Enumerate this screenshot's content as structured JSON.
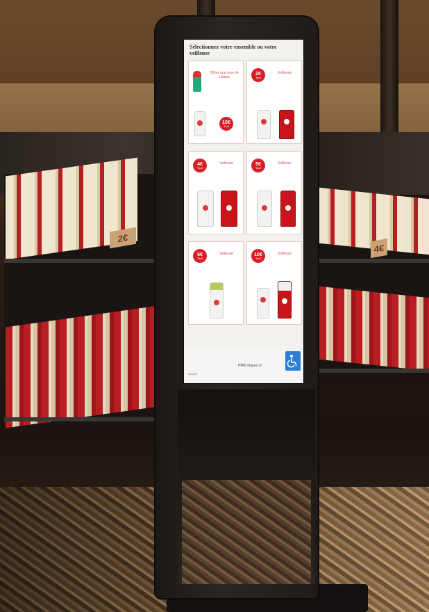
{
  "screen": {
    "title": "Sélectionnez votre ensemble ou votre veilleuse",
    "cards": [
      {
        "id": "offer",
        "text": "Offrez une rose de Lisieux",
        "badge": "10€",
        "badge_sub": "Tarif"
      },
      {
        "id": "c2",
        "badge": "2€",
        "badge_sub": "Tarif",
        "text": "Veilleuse"
      },
      {
        "id": "c4",
        "badge": "4€",
        "badge_sub": "Tarif",
        "text": "Veilleuse"
      },
      {
        "id": "c5",
        "badge": "5€",
        "badge_sub": "Tarif",
        "text": "Veilleuse"
      },
      {
        "id": "c6",
        "badge": "6€",
        "badge_sub": "Tarif",
        "text": "Veilleuse"
      },
      {
        "id": "c10",
        "badge": "10€",
        "badge_sub": "Tarif",
        "text": "Veilleuse"
      }
    ],
    "pmr_label": "PMR cliquez ici",
    "home_label": "Accueil"
  },
  "price_tags": {
    "left": "2€",
    "right": "4€"
  },
  "colors": {
    "accent_red": "#d91f26",
    "wheelchair_blue": "#2f7ed6"
  },
  "icons": [
    "wheelchair-icon"
  ]
}
